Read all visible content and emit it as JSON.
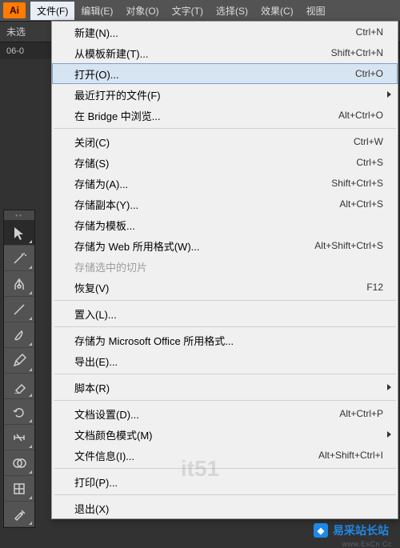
{
  "logo": "Ai",
  "menubar": [
    {
      "label": "文件(F)",
      "open": true
    },
    {
      "label": "编辑(E)",
      "open": false
    },
    {
      "label": "对象(O)",
      "open": false
    },
    {
      "label": "文字(T)",
      "open": false
    },
    {
      "label": "选择(S)",
      "open": false
    },
    {
      "label": "效果(C)",
      "open": false
    },
    {
      "label": "视图",
      "open": false
    }
  ],
  "substrip": {
    "label": "未选"
  },
  "doc_tab": {
    "label": "06-0"
  },
  "file_menu": [
    {
      "type": "item",
      "label": "新建(N)...",
      "shortcut": "Ctrl+N"
    },
    {
      "type": "item",
      "label": "从模板新建(T)...",
      "shortcut": "Shift+Ctrl+N"
    },
    {
      "type": "item",
      "label": "打开(O)...",
      "shortcut": "Ctrl+O",
      "highlighted": true
    },
    {
      "type": "item",
      "label": "最近打开的文件(F)",
      "submenu": true
    },
    {
      "type": "item",
      "label": "在 Bridge 中浏览...",
      "shortcut": "Alt+Ctrl+O"
    },
    {
      "type": "sep"
    },
    {
      "type": "item",
      "label": "关闭(C)",
      "shortcut": "Ctrl+W"
    },
    {
      "type": "item",
      "label": "存储(S)",
      "shortcut": "Ctrl+S"
    },
    {
      "type": "item",
      "label": "存储为(A)...",
      "shortcut": "Shift+Ctrl+S"
    },
    {
      "type": "item",
      "label": "存储副本(Y)...",
      "shortcut": "Alt+Ctrl+S"
    },
    {
      "type": "item",
      "label": "存储为模板..."
    },
    {
      "type": "item",
      "label": "存储为 Web 所用格式(W)...",
      "shortcut": "Alt+Shift+Ctrl+S"
    },
    {
      "type": "item",
      "label": "存储选中的切片",
      "disabled": true
    },
    {
      "type": "item",
      "label": "恢复(V)",
      "shortcut": "F12"
    },
    {
      "type": "sep"
    },
    {
      "type": "item",
      "label": "置入(L)..."
    },
    {
      "type": "sep"
    },
    {
      "type": "item",
      "label": "存储为 Microsoft Office 所用格式..."
    },
    {
      "type": "item",
      "label": "导出(E)..."
    },
    {
      "type": "sep"
    },
    {
      "type": "item",
      "label": "脚本(R)",
      "submenu": true
    },
    {
      "type": "sep"
    },
    {
      "type": "item",
      "label": "文档设置(D)...",
      "shortcut": "Alt+Ctrl+P"
    },
    {
      "type": "item",
      "label": "文档颜色模式(M)",
      "submenu": true
    },
    {
      "type": "item",
      "label": "文件信息(I)...",
      "shortcut": "Alt+Shift+Ctrl+I"
    },
    {
      "type": "sep"
    },
    {
      "type": "item",
      "label": "打印(P)..."
    },
    {
      "type": "sep"
    },
    {
      "type": "item",
      "label": "退出(X)"
    }
  ],
  "tools": [
    {
      "name": "selection-icon",
      "active": true
    },
    {
      "name": "magic-wand-icon"
    },
    {
      "name": "pen-icon"
    },
    {
      "name": "line-icon"
    },
    {
      "name": "paintbrush-icon"
    },
    {
      "name": "pencil-icon"
    },
    {
      "name": "eraser-icon"
    },
    {
      "name": "rotate-icon"
    },
    {
      "name": "width-icon"
    },
    {
      "name": "shape-builder-icon"
    },
    {
      "name": "mesh-icon"
    },
    {
      "name": "eyedropper-icon"
    }
  ],
  "watermark": {
    "brand": "易采站长站",
    "center": "it51",
    "sub": "www.EsCn Cc"
  }
}
